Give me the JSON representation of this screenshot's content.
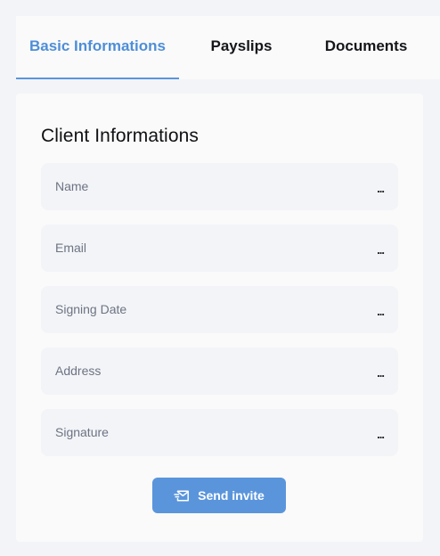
{
  "tabs": [
    {
      "label": "Basic Informations",
      "active": true
    },
    {
      "label": "Payslips",
      "active": false
    },
    {
      "label": "Documents",
      "active": false
    }
  ],
  "card": {
    "title": "Client Informations",
    "fields": [
      {
        "label": "Name",
        "action": "..."
      },
      {
        "label": "Email",
        "action": "..."
      },
      {
        "label": "Signing Date",
        "action": "..."
      },
      {
        "label": "Address",
        "action": "..."
      },
      {
        "label": "Signature",
        "action": "..."
      }
    ],
    "send_button": {
      "label": "Send invite",
      "icon": "send-mail-icon"
    }
  },
  "colors": {
    "accent": "#5a95dc",
    "active_tab_text": "#4e8ed8",
    "page_background": "#f3f4f8",
    "card_background": "#fafafa",
    "field_background": "#f3f4f7",
    "field_label": "#6d7384"
  }
}
